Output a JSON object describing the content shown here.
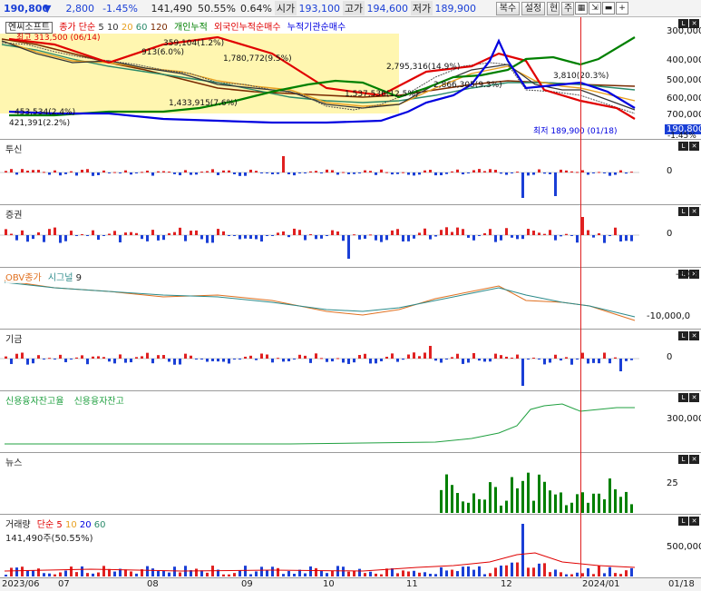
{
  "toolbar": {
    "price": "190,800",
    "arrow": "▼",
    "change": "2,800",
    "change_pct": "-1.45%",
    "volume": "141,490",
    "vol_ratio": "50.55%",
    "pct2": "0.64%",
    "open_label": "시가",
    "open_value": "193,100",
    "high_label": "고가",
    "high_value": "194,600",
    "low_label": "저가",
    "low_value": "189,900",
    "btn_copy": "복수",
    "btn_settings": "설정",
    "btn_current": "현",
    "btn_week": "주"
  },
  "main": {
    "stock_name": "엔씨소프트",
    "legend": [
      "종가",
      "단순",
      "5",
      "10",
      "20",
      "60",
      "120",
      "개인누적",
      "외국인누적순매수",
      "누적기관순매수"
    ],
    "y_ticks": [
      "300,000",
      "400,000",
      "500,000",
      "600,000",
      "700,000"
    ],
    "current_price_tag": "190,800",
    "current_pct_tag": "-1.45%",
    "annotations": [
      "최고 313,500 (06/14)",
      "359,104(1.2%)",
      "913(6.0%)",
      "1,780,772(9.5%)",
      "2,795,316(14.9%)",
      "3,810(20.3%)",
      "2,866,305(9.3%)",
      "1,433,915(7.6%)",
      "1,537,536(12.5%)",
      "453,534(2.4%)",
      "421,391(2.2%)",
      "최저 189,900 (01/18)"
    ]
  },
  "panes": {
    "investment_trust": {
      "label": "투신",
      "tick": "0"
    },
    "securities": {
      "label": "증권",
      "tick": "0"
    },
    "obv": {
      "label": "OBV종가",
      "signal": "시그널",
      "signal_n": "9",
      "ticks": [
        "-500",
        "-10,000,0"
      ]
    },
    "other": {
      "label": "기금",
      "tick": "0"
    },
    "credit": {
      "label1": "신용융자잔고율",
      "label2": "신용융자잔고",
      "tick": "300,000"
    },
    "news": {
      "label": "뉴스",
      "tick": "25"
    },
    "volume": {
      "label": "거래량",
      "ma_label": "단순",
      "ma": [
        "5",
        "10",
        "20",
        "60"
      ],
      "value_text": "141,490주(50.55%)",
      "tick": "500,000"
    }
  },
  "x_axis": {
    "labels": [
      "2023/06",
      "07",
      "08",
      "09",
      "10",
      "11",
      "12",
      "2024/01",
      "01/18"
    ]
  },
  "colors": {
    "rise": "#e02020",
    "fall": "#1a3fd6",
    "individual": "#e00000",
    "foreign": "#008000",
    "institution": "#0000e0",
    "highlight": "#fff6b0"
  }
}
